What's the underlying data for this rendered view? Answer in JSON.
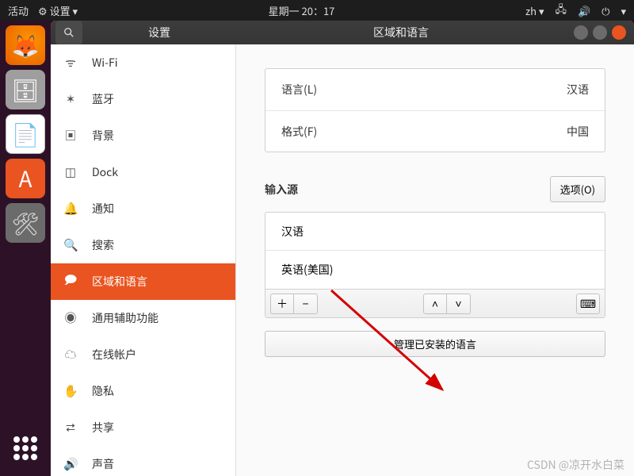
{
  "top_panel": {
    "activities": "活动",
    "app_menu": "设置",
    "clock": "星期一 20：17",
    "lang": "zh"
  },
  "titlebar": {
    "left_title": "设置",
    "right_title": "区域和语言"
  },
  "sidebar": [
    {
      "icon": "wifi",
      "label": "Wi-Fi"
    },
    {
      "icon": "bluetooth",
      "label": "蓝牙"
    },
    {
      "icon": "background",
      "label": "背景"
    },
    {
      "icon": "dock",
      "label": "Dock"
    },
    {
      "icon": "bell",
      "label": "通知"
    },
    {
      "icon": "search",
      "label": "搜索"
    },
    {
      "icon": "region",
      "label": "区域和语言"
    },
    {
      "icon": "accessibility",
      "label": "通用辅助功能"
    },
    {
      "icon": "online",
      "label": "在线帐户"
    },
    {
      "icon": "privacy",
      "label": "隐私"
    },
    {
      "icon": "share",
      "label": "共享"
    },
    {
      "icon": "sound",
      "label": "声音"
    }
  ],
  "selected_index": 6,
  "region": {
    "language_label": "语言(L)",
    "language_value": "汉语",
    "format_label": "格式(F)",
    "format_value": "中国",
    "input_sources_title": "输入源",
    "options_btn": "选项(O)",
    "sources": [
      "汉语",
      "英语(美国)"
    ],
    "manage_btn": "管理已安装的语言"
  },
  "watermark": "CSDN @凉开水白菜"
}
